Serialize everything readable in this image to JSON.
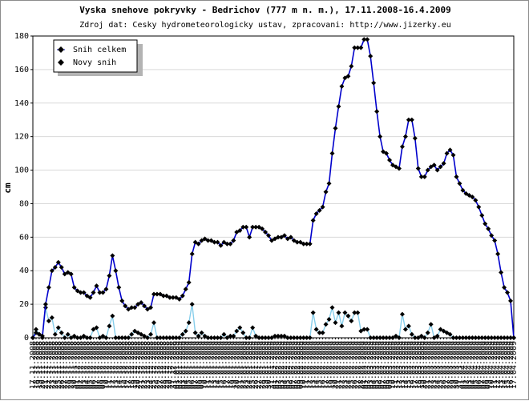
{
  "chart_data": {
    "type": "line",
    "title": "Vyska snehove pokryvky - Bedrichov (777 m n. m.), 17.11.2008-16.4.2009",
    "subtitle": "Zdroj dat: Cesky hydrometeorologicky ustav, zpracovani: http://www.jizerky.eu",
    "xlabel": "",
    "ylabel": "cm",
    "ylim": [
      0,
      180
    ],
    "yticks": [
      0,
      20,
      40,
      60,
      80,
      100,
      120,
      140,
      160,
      180
    ],
    "x_start": "2008-11-17",
    "x_end": "2009-04-16",
    "grid": true,
    "legend": {
      "position": "top-left"
    },
    "series": [
      {
        "name": "Snih celkem",
        "color": "#0000cc",
        "values": [
          0,
          3,
          2,
          1,
          20,
          30,
          40,
          42,
          45,
          42,
          38,
          39,
          38,
          30,
          28,
          27,
          27,
          25,
          24,
          27,
          31,
          27,
          27,
          29,
          37,
          49,
          40,
          30,
          22,
          19,
          17,
          18,
          18,
          20,
          21,
          19,
          17,
          18,
          26,
          26,
          26,
          25,
          25,
          24,
          24,
          24,
          23,
          25,
          29,
          33,
          50,
          57,
          56,
          58,
          59,
          58,
          58,
          57,
          57,
          55,
          57,
          56,
          56,
          58,
          63,
          64,
          66,
          66,
          60,
          66,
          66,
          66,
          65,
          63,
          61,
          58,
          59,
          60,
          60,
          61,
          59,
          60,
          58,
          57,
          57,
          56,
          56,
          56,
          70,
          74,
          76,
          78,
          87,
          92,
          110,
          125,
          138,
          150,
          155,
          156,
          162,
          173,
          173,
          173,
          178,
          178,
          168,
          152,
          135,
          120,
          111,
          110,
          106,
          103,
          102,
          101,
          114,
          120,
          130,
          130,
          119,
          101,
          96,
          96,
          100,
          102,
          103,
          100,
          102,
          104,
          110,
          112,
          109,
          96,
          92,
          88,
          86,
          85,
          84,
          82,
          78,
          73,
          68,
          65,
          61,
          58,
          50,
          39,
          30,
          27,
          22,
          0
        ]
      },
      {
        "name": "Novy snih",
        "color": "#87ceeb",
        "values": [
          0,
          5,
          2,
          0,
          18,
          10,
          12,
          2,
          6,
          3,
          0,
          2,
          0,
          1,
          0,
          0,
          1,
          0,
          0,
          5,
          6,
          0,
          1,
          0,
          7,
          13,
          0,
          0,
          0,
          0,
          0,
          2,
          4,
          3,
          2,
          1,
          0,
          2,
          9,
          0,
          0,
          0,
          0,
          0,
          0,
          0,
          0,
          2,
          4,
          9,
          20,
          3,
          1,
          3,
          1,
          0,
          0,
          0,
          0,
          0,
          2,
          0,
          1,
          1,
          4,
          6,
          3,
          0,
          0,
          6,
          1,
          0,
          0,
          0,
          0,
          0,
          1,
          1,
          1,
          1,
          0,
          0,
          0,
          0,
          0,
          0,
          0,
          0,
          15,
          5,
          3,
          3,
          8,
          11,
          18,
          9,
          15,
          7,
          15,
          13,
          10,
          15,
          15,
          4,
          5,
          5,
          0,
          0,
          0,
          0,
          0,
          0,
          0,
          0,
          1,
          0,
          14,
          5,
          7,
          2,
          0,
          0,
          1,
          0,
          3,
          8,
          0,
          1,
          5,
          4,
          3,
          2,
          0,
          0,
          0,
          0,
          0,
          0,
          0,
          0,
          0,
          0,
          0,
          0,
          0,
          0,
          0,
          0,
          0,
          0,
          0,
          0
        ]
      }
    ]
  }
}
